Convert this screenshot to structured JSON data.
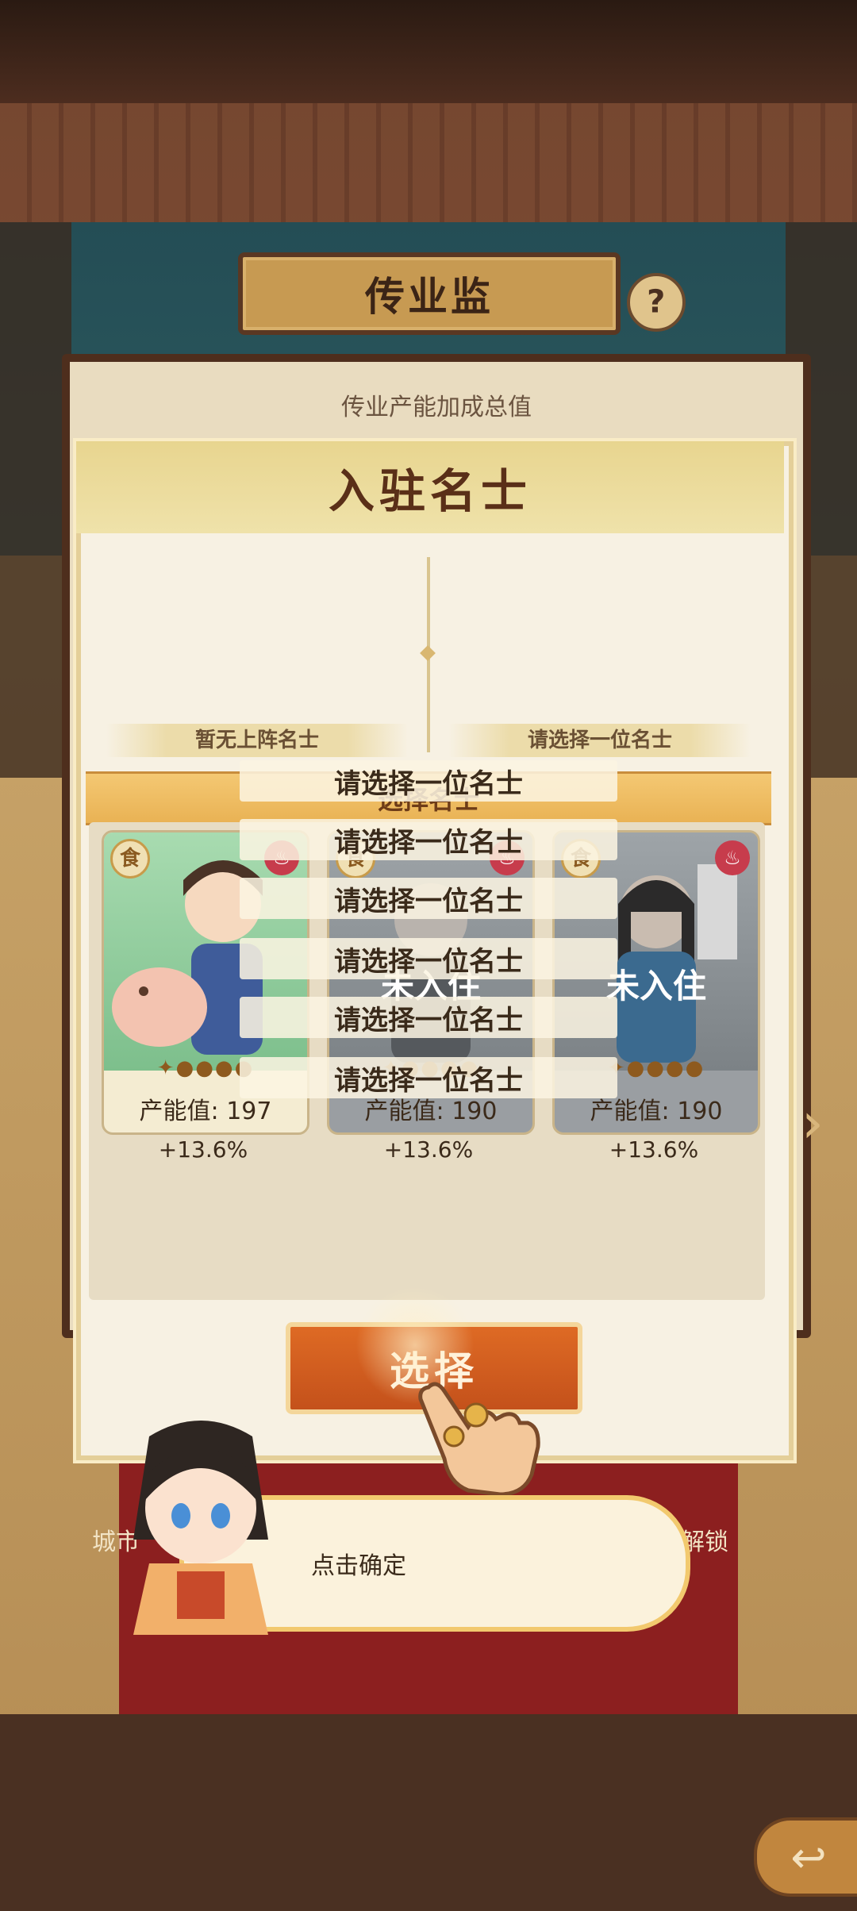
{
  "screen": {
    "title": "传业监",
    "help_label": "?",
    "bonus_total_label": "传业产能加成总值",
    "bottom_left_text": "城市",
    "bottom_right_text": "级解锁",
    "side_arrow": "›",
    "back_label": "↩"
  },
  "modal": {
    "title": "入驻名士",
    "slots": [
      {
        "label": "暂无上阵名士"
      },
      {
        "label": "请选择一位名士"
      }
    ],
    "select_bar_label": "选择名士",
    "cards": [
      {
        "food_icon": "食",
        "tag_icon": "♨",
        "stars": "✦●●●●",
        "value": "产能值: 197",
        "bonus": "+13.6%",
        "status": "",
        "color": "#8fc99a"
      },
      {
        "food_icon": "食",
        "tag_icon": "♨",
        "stars": "✦●●●●",
        "value": "产能值: 190",
        "bonus": "+13.6%",
        "status": "未入住",
        "color": "#8a8f94"
      },
      {
        "food_icon": "食",
        "tag_icon": "♨",
        "stars": "✦●●●●",
        "value": "产能值: 190",
        "bonus": "+13.6%",
        "status": "未入住",
        "color": "#8a8f94"
      }
    ],
    "dropdown_items": [
      "请选择一位名士",
      "请选择一位名士",
      "请选择一位名士",
      "请选择一位名士",
      "请选择一位名士",
      "请选择一位名士"
    ],
    "select_button_label": "选择"
  },
  "guide": {
    "dialog_text": "点击确定"
  },
  "colors": {
    "accent_orange": "#d45e1f",
    "gold": "#e9b254",
    "panel": "#f7f1e3"
  }
}
